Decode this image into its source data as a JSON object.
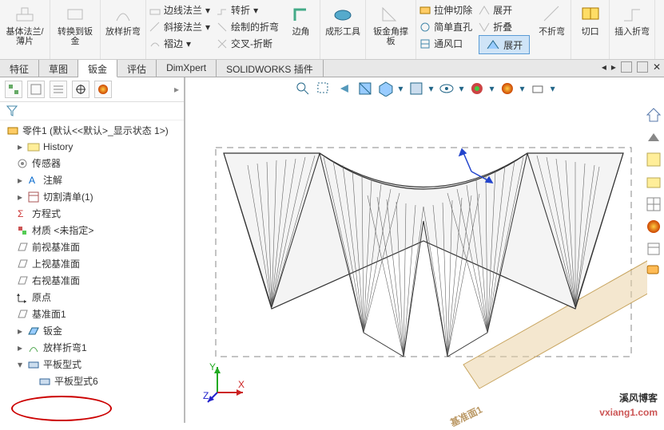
{
  "ribbon": {
    "baseFlange": "基体法兰/薄片",
    "convert": "转换到钣金",
    "loftBend": "放样折弯",
    "edgeFlange": "边线法兰",
    "miter": "斜接法兰",
    "hem": "褶边",
    "jog": "转折",
    "sketchBend": "绘制的折弯",
    "crossBreak": "交叉-折断",
    "corner": "边角",
    "formTool": "成形工具",
    "gusset": "钣金角撑板",
    "extrudeCut": "拉伸切除",
    "simpleHole": "简单直孔",
    "vent": "通风口",
    "unfold": "展开",
    "fold": "折叠",
    "noBend": "不折弯",
    "expand": "展开",
    "rip": "切口",
    "insertBend": "插入折弯"
  },
  "tabs": {
    "t1": "特征",
    "t2": "草图",
    "t3": "钣金",
    "t4": "评估",
    "t5": "DimXpert",
    "t6": "SOLIDWORKS 插件"
  },
  "tree": {
    "root": "零件1 (默认<<默认>_显示状态 1>)",
    "history": "History",
    "sensor": "传感器",
    "annot": "注解",
    "cutlist": "切割清单(1)",
    "equations": "方程式",
    "material": "材质 <未指定>",
    "front": "前视基准面",
    "top": "上视基准面",
    "right": "右视基准面",
    "origin": "原点",
    "plane1": "基准面1",
    "sheetmetal": "钣金",
    "loftedBend1": "放样折弯1",
    "flatPattern": "平板型式",
    "flatPattern6": "平板型式6"
  },
  "viewport": {
    "planeLabel": "基准面1"
  },
  "watermark": {
    "title": "溪风博客",
    "url": "vxiang1.com"
  }
}
